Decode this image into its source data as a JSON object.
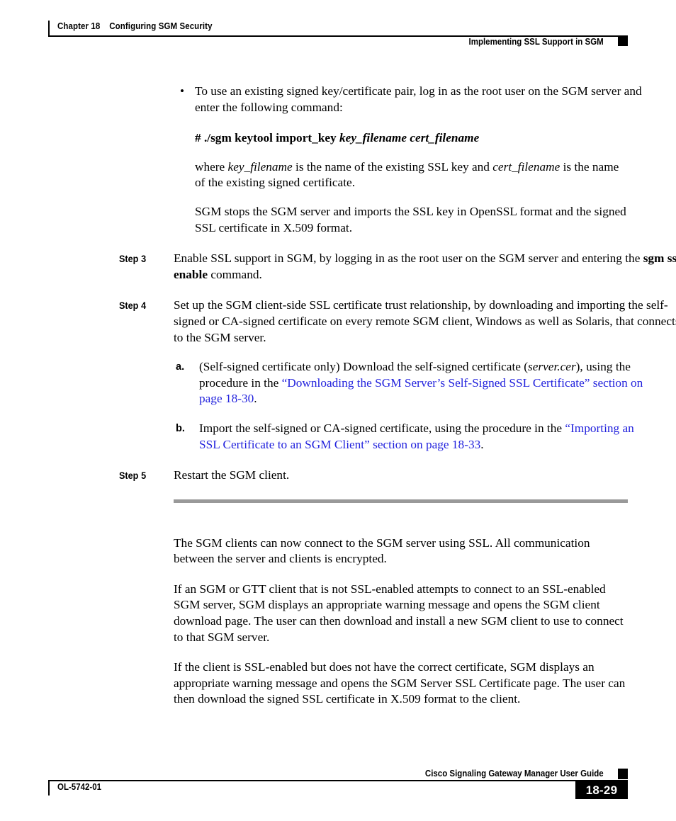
{
  "header": {
    "chapter_number": "Chapter 18",
    "chapter_title": "Configuring SGM Security",
    "section_title": "Implementing SSL Support in SGM"
  },
  "body": {
    "bullet": {
      "marker": "•",
      "text_part1": "To use an existing signed key/certificate pair, log in as the root user on the SGM server and enter the following command:"
    },
    "command": {
      "prompt_and_command": "# ./sgm keytool import_key",
      "arg1": "key_filename",
      "arg2": "cert_filename"
    },
    "where_para": {
      "lead": "where ",
      "arg1": "key_filename",
      "mid": " is the name of the existing SSL key and ",
      "arg2": "cert_filename",
      "tail": " is the name of the existing signed certificate."
    },
    "sgm_stops_para": "SGM stops the SGM server and imports the SSL key in OpenSSL format and the signed SSL certificate in X.509 format.",
    "steps": [
      {
        "label": "Step",
        "number": "3",
        "text_before": "Enable SSL support in SGM, by logging in as the root user on the SGM server and entering the ",
        "bold_command": "sgm ssl enable",
        "text_after": " command."
      },
      {
        "label": "Step",
        "number": "4",
        "text_before": "Set up the SGM client-side SSL certificate trust relationship, by downloading and importing the self-signed or CA-signed certificate on every remote SGM client, Windows as well as Solaris, that connects to the SGM server.",
        "bold_command": "",
        "text_after": ""
      },
      {
        "label": "Step",
        "number": "5",
        "text_before": "Restart the SGM client.",
        "bold_command": "",
        "text_after": ""
      }
    ],
    "substeps": [
      {
        "letter": "a.",
        "text_before": "(Self-signed certificate only) Download the self-signed certificate (",
        "italic_file": "server.cer",
        "text_mid": "), using the procedure in the ",
        "link_text": "“Downloading the SGM Server’s Self-Signed SSL Certificate” section on page 18-30",
        "text_after": "."
      },
      {
        "letter": "b.",
        "text_before": "Import the self-signed or CA-signed certificate, using the procedure in the ",
        "italic_file": "",
        "text_mid": "",
        "link_text": "“Importing an SSL Certificate to an SGM Client” section on page 18-33",
        "text_after": "."
      }
    ],
    "closing_paragraphs": [
      "The SGM clients can now connect to the SGM server using SSL. All communication between the server and clients is encrypted.",
      "If an SGM or GTT client that is not SSL-enabled attempts to connect to an SSL-enabled SGM server, SGM displays an appropriate warning message and opens the SGM client download page. The user can then download and install a new SGM client to use to connect to that SGM server.",
      "If the client is SSL-enabled but does not have the correct certificate, SGM displays an appropriate warning message and opens the SGM Server SSL Certificate page. The user can then download the signed SSL certificate in X.509 format to the client."
    ]
  },
  "footer": {
    "guide_title": "Cisco Signaling Gateway Manager User Guide",
    "document_id": "OL-5742-01",
    "page_number": "18-29"
  },
  "colors": {
    "link_blue": "#2222dd",
    "divider_gray": "#999999",
    "text_black": "#000000"
  }
}
